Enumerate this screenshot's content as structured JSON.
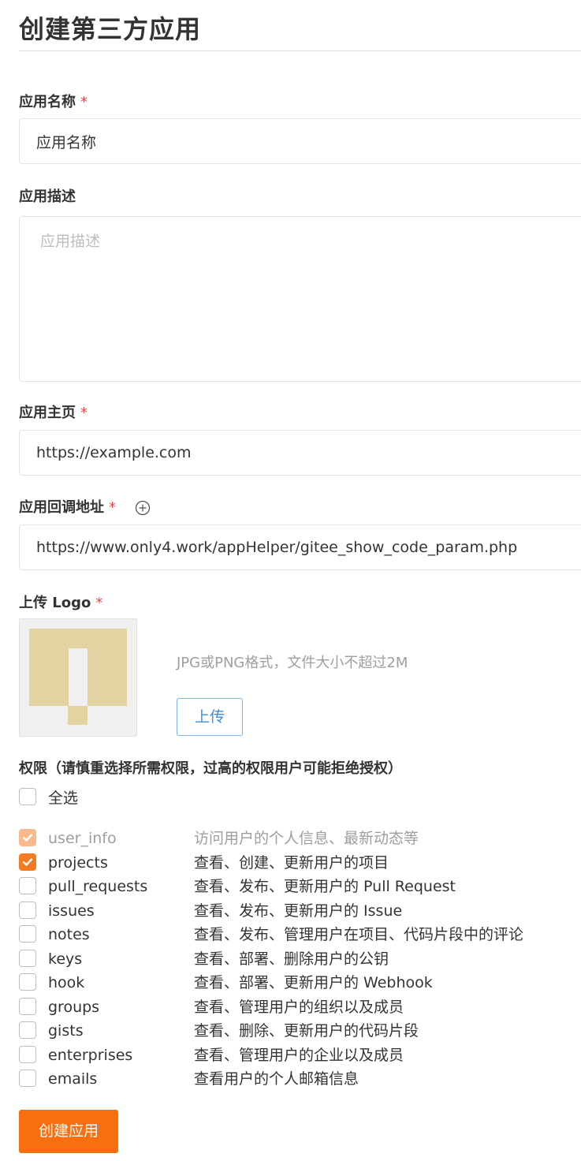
{
  "page_title": "创建第三方应用",
  "form": {
    "name": {
      "label": "应用名称",
      "required_mark": "*",
      "value": "应用名称"
    },
    "description": {
      "label": "应用描述",
      "placeholder": "应用描述"
    },
    "homepage": {
      "label": "应用主页",
      "required_mark": "*",
      "value": "https://example.com"
    },
    "callback": {
      "label": "应用回调地址",
      "required_mark": "*",
      "value": "https://www.only4.work/appHelper/gitee_show_code_param.php",
      "add_icon": "plus-circle-icon"
    },
    "logo": {
      "label": "上传 Logo",
      "required_mark": "*",
      "hint": "JPG或PNG格式，文件大小不超过2M",
      "upload_label": "上传"
    }
  },
  "permissions": {
    "title": "权限（请慎重选择所需权限，过高的权限用户可能拒绝授权）",
    "select_all_label": "全选",
    "items": [
      {
        "name": "user_info",
        "desc": "访问用户的个人信息、最新动态等",
        "checked": true,
        "disabled": true
      },
      {
        "name": "projects",
        "desc": "查看、创建、更新用户的项目",
        "checked": true,
        "disabled": false
      },
      {
        "name": "pull_requests",
        "desc": "查看、发布、更新用户的 Pull Request",
        "checked": false,
        "disabled": false
      },
      {
        "name": "issues",
        "desc": "查看、发布、更新用户的 Issue",
        "checked": false,
        "disabled": false
      },
      {
        "name": "notes",
        "desc": "查看、发布、管理用户在项目、代码片段中的评论",
        "checked": false,
        "disabled": false
      },
      {
        "name": "keys",
        "desc": "查看、部署、删除用户的公钥",
        "checked": false,
        "disabled": false
      },
      {
        "name": "hook",
        "desc": "查看、部署、更新用户的 Webhook",
        "checked": false,
        "disabled": false
      },
      {
        "name": "groups",
        "desc": "查看、管理用户的组织以及成员",
        "checked": false,
        "disabled": false
      },
      {
        "name": "gists",
        "desc": "查看、删除、更新用户的代码片段",
        "checked": false,
        "disabled": false
      },
      {
        "name": "enterprises",
        "desc": "查看、管理用户的企业以及成员",
        "checked": false,
        "disabled": false
      },
      {
        "name": "emails",
        "desc": "查看用户的个人邮箱信息",
        "checked": false,
        "disabled": false
      }
    ]
  },
  "submit_label": "创建应用",
  "colors": {
    "accent": "#f76f0f",
    "checkbox_checked": "#f47b20",
    "required": "#e24b4b",
    "link_blue": "#3b8fe0",
    "logo_tile": "#e3d3a0"
  }
}
